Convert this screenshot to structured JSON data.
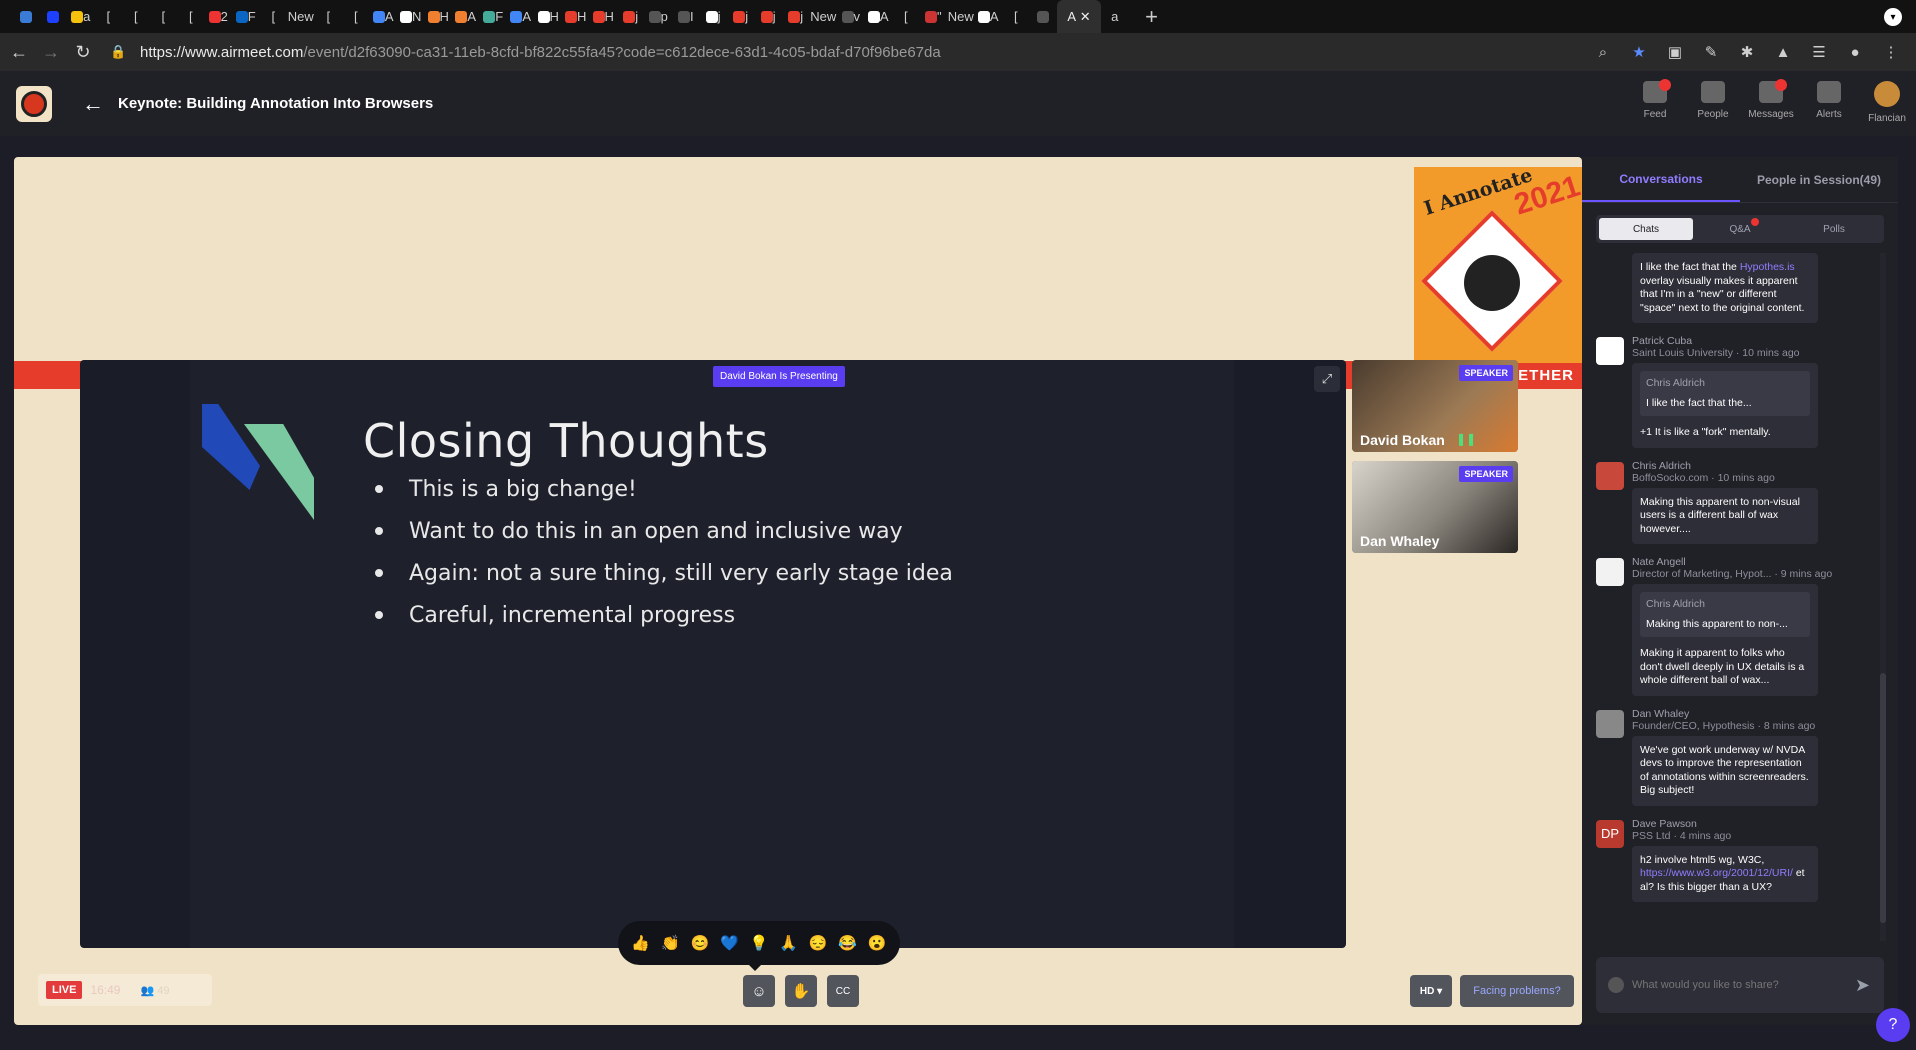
{
  "browser": {
    "tabs": [
      {
        "label": "",
        "color": "#3a7bd5",
        "icon": "app-icon"
      },
      {
        "label": "",
        "color": "#1e40ff",
        "icon": "app-icon"
      },
      {
        "label": "a",
        "color": "#f4c20d",
        "icon": "slides-icon"
      },
      {
        "label": "[",
        "color": "",
        "icon": ""
      },
      {
        "label": "[",
        "color": "",
        "icon": ""
      },
      {
        "label": "[",
        "color": "",
        "icon": ""
      },
      {
        "label": "[",
        "color": "",
        "icon": ""
      },
      {
        "label": "2",
        "color": "#e33",
        "icon": "app-icon"
      },
      {
        "label": "F",
        "color": "#0a66c2",
        "icon": "linkedin-icon"
      },
      {
        "label": "[",
        "color": "",
        "icon": ""
      },
      {
        "label": "New",
        "color": "",
        "icon": ""
      },
      {
        "label": "[",
        "color": "",
        "icon": ""
      },
      {
        "label": "[",
        "color": "",
        "icon": ""
      },
      {
        "label": "A",
        "color": "#4285f4",
        "icon": "docs-icon"
      },
      {
        "label": "N",
        "color": "#fff",
        "icon": "app-icon"
      },
      {
        "label": "H",
        "color": "#f08030",
        "icon": "app-icon"
      },
      {
        "label": "A",
        "color": "#f08030",
        "icon": "app-icon"
      },
      {
        "label": "F",
        "color": "#4a9",
        "icon": "app-icon"
      },
      {
        "label": "A",
        "color": "#4285f4",
        "icon": "drive-icon"
      },
      {
        "label": "H",
        "color": "#fff",
        "icon": "wikipedia-icon"
      },
      {
        "label": "H",
        "color": "#e63c2c",
        "icon": "app-icon"
      },
      {
        "label": "H",
        "color": "#e63c2c",
        "icon": "app-icon"
      },
      {
        "label": "j",
        "color": "#e63c2c",
        "icon": "app-icon"
      },
      {
        "label": "p",
        "color": "#555",
        "icon": "github-icon"
      },
      {
        "label": "I",
        "color": "#555",
        "icon": "github-icon"
      },
      {
        "label": "j",
        "color": "#fff",
        "icon": "app-icon"
      },
      {
        "label": "j",
        "color": "#e63c2c",
        "icon": "app-icon"
      },
      {
        "label": "j",
        "color": "#e63c2c",
        "icon": "app-icon"
      },
      {
        "label": "j",
        "color": "#e63c2c",
        "icon": "app-icon"
      },
      {
        "label": "New",
        "color": "",
        "icon": ""
      },
      {
        "label": "v",
        "color": "#555",
        "icon": "github-icon"
      },
      {
        "label": "A",
        "color": "#fff",
        "icon": "app-icon"
      },
      {
        "label": "[",
        "color": "",
        "icon": ""
      },
      {
        "label": "\"",
        "color": "#c33",
        "icon": "app-icon"
      },
      {
        "label": "New",
        "color": "",
        "icon": ""
      },
      {
        "label": "A",
        "color": "#fff",
        "icon": "app-icon"
      },
      {
        "label": "[",
        "color": "",
        "icon": ""
      },
      {
        "label": "",
        "color": "#555",
        "icon": "github-icon"
      }
    ],
    "active_tab": {
      "label": "A"
    },
    "after_tab": {
      "label": "a"
    },
    "url_host": "https://www.airmeet.com",
    "url_rest": "/event/d2f63090-ca31-11eb-8cfd-bf822c55fa45?code=c612dece-63d1-4c05-bdaf-d70f96be67da"
  },
  "header": {
    "title": "Keynote: Building Annotation Into Browsers",
    "nav": [
      {
        "label": "Feed",
        "badge": true
      },
      {
        "label": "People",
        "badge": false
      },
      {
        "label": "Messages",
        "badge": true
      },
      {
        "label": "Alerts",
        "badge": false
      },
      {
        "label": "Flancian",
        "badge": false
      }
    ]
  },
  "stage": {
    "banner_text": "GETHER",
    "badge_title": "I Annotate",
    "badge_year": "2021",
    "presenting": "David Bokan Is Presenting",
    "slide": {
      "title": "Closing Thoughts",
      "bullets": [
        "This is a big change!",
        "Want to do this in an open and inclusive way",
        "Again: not a sure thing, still very early stage idea",
        "Careful, incremental progress"
      ]
    },
    "speakers": [
      {
        "name": "David Bokan",
        "tag": "SPEAKER"
      },
      {
        "name": "Dan Whaley",
        "tag": "SPEAKER"
      }
    ],
    "reactions": [
      "👍",
      "👏",
      "😊",
      "💙",
      "💡",
      "🙏",
      "😔",
      "😂",
      "😮"
    ],
    "live": "LIVE",
    "timer": "16:49",
    "viewers": "49",
    "hd": "HD",
    "facing": "Facing problems?"
  },
  "panel": {
    "tabs": [
      "Conversations",
      "People in Session(49)"
    ],
    "segments": [
      "Chats",
      "Q&A",
      "Polls"
    ],
    "messages": [
      {
        "body_pre": "I like the fact that the ",
        "link": "Hypothes.is",
        "body_post": " overlay visually makes it apparent that I'm in a \"new\" or different \"space\" next to the original content."
      },
      {
        "name": "Patrick Cuba",
        "org": "Saint Louis University · 10 mins ago",
        "quote_name": "Chris Aldrich",
        "quote": "I like the fact that the...",
        "body": "+1 It is like a \"fork\" mentally."
      },
      {
        "name": "Chris Aldrich",
        "org": "BoffoSocko.com · 10 mins ago",
        "body": "Making this apparent to non-visual users is a different ball of wax however...."
      },
      {
        "name": "Nate Angell",
        "org": "Director of Marketing, Hypot... · 9 mins ago",
        "quote_name": "Chris Aldrich",
        "quote": "Making this apparent to non-...",
        "body": "Making it apparent to folks who don't dwell deeply in UX details is a whole different ball of wax..."
      },
      {
        "name": "Dan Whaley",
        "org": "Founder/CEO, Hypothesis · 8 mins ago",
        "body": "We've got work underway w/ NVDA devs to improve the representation of annotations within screenreaders. Big subject!"
      },
      {
        "name": "Dave Pawson",
        "org": "PSS Ltd · 4 mins ago",
        "initials": "DP",
        "body_pre": "h2 involve html5 wg, W3C, ",
        "link": "https://www.w3.org/2001/12/URI/",
        "body_post": " et al? Is this bigger than a UX?"
      }
    ],
    "compose_placeholder": "What would you like to share?"
  },
  "colors": {
    "accent": "#5a3df0",
    "live": "#e33b3b",
    "stage_bg": "#efe2c6",
    "banner": "#e63c2c"
  }
}
